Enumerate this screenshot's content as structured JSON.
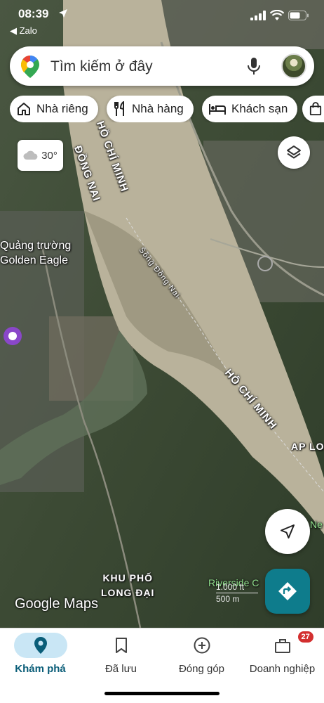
{
  "status_bar": {
    "time": "08:39",
    "back_app": "◀ Zalo"
  },
  "search": {
    "placeholder": "Tìm kiếm ở đây"
  },
  "chips": [
    {
      "label": "Nhà riêng",
      "icon": "home-icon"
    },
    {
      "label": "Nhà hàng",
      "icon": "restaurant-icon"
    },
    {
      "label": "Khách sạn",
      "icon": "hotel-icon"
    },
    {
      "label": "",
      "icon": "shopping-bag-icon"
    }
  ],
  "weather": {
    "temperature": "30°",
    "icon": "cloud-icon"
  },
  "map": {
    "labels": {
      "dong_nai": "ĐỒNG NAI",
      "hcm_top": "HỒ CHÍ MINH",
      "plaza_line1": "Quảng trường",
      "plaza_line2": "Golden Eagle",
      "river": "Sông Đồng Nai",
      "hcm_right": "HỒ CHÍ MINH",
      "ap_lo": "AP LO",
      "ne": "Ne",
      "district_line1": "KHU PHỐ",
      "district_line2": "LONG ĐẠI",
      "riverside": "Riverside C"
    },
    "scale": {
      "ft": "1.000 ft",
      "m": "500 m"
    },
    "attribution": "Google Maps"
  },
  "bottom_nav": {
    "items": [
      {
        "label": "Khám phá",
        "icon": "explore-pin-icon",
        "active": true
      },
      {
        "label": "Đã lưu",
        "icon": "bookmark-icon"
      },
      {
        "label": "Đóng góp",
        "icon": "add-circle-icon"
      },
      {
        "label": "Doanh nghiệp",
        "icon": "business-icon",
        "badge": "27"
      }
    ]
  },
  "colors": {
    "accent": "#0e7c8c",
    "nav_active_bg": "#c9e6f5",
    "badge": "#d32f2f"
  }
}
